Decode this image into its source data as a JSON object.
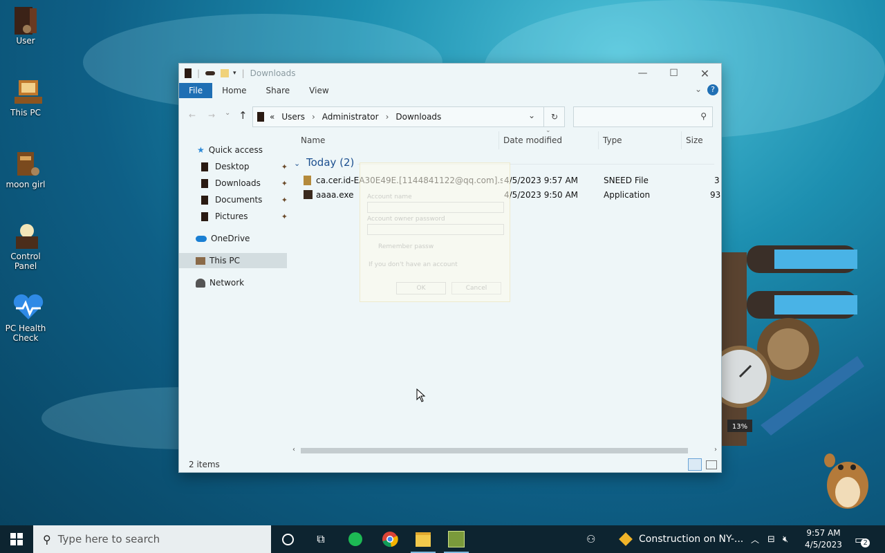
{
  "desktop": {
    "icons": [
      {
        "label": "User"
      },
      {
        "label": "This PC"
      },
      {
        "label": "moon girl"
      },
      {
        "label": "Control Panel"
      },
      {
        "label": "PC Health Check"
      }
    ],
    "gadget_percent": "13%"
  },
  "explorer": {
    "title": "Downloads",
    "ribbon_tabs": [
      "File",
      "Home",
      "Share",
      "View"
    ],
    "breadcrumb": [
      "Users",
      "Administrator",
      "Downloads"
    ],
    "breadcrumb_prefix": "«",
    "search_placeholder": "",
    "sidebar": {
      "quick_access": "Quick access",
      "pinned": [
        "Desktop",
        "Downloads",
        "Documents",
        "Pictures"
      ],
      "onedrive": "OneDrive",
      "this_pc": "This PC",
      "network": "Network"
    },
    "columns": [
      "Name",
      "Date modified",
      "Type",
      "Size"
    ],
    "group_header": "Today (2)",
    "files": [
      {
        "name": "ca.cer.id-EA30E49E.[1144841122@qq.com].sn...",
        "date": "4/5/2023 9:57 AM",
        "type": "SNEED File",
        "size": "3"
      },
      {
        "name": "aaaa.exe",
        "date": "4/5/2023 9:50 AM",
        "type": "Application",
        "size": "93"
      }
    ],
    "status": "2 items"
  },
  "ghost_dialog": {
    "account_name_label": "Account name",
    "password_label": "Account owner password",
    "remember": "Remember passw",
    "no_account": "If you don't have an account",
    "ok": "OK",
    "cancel": "Cancel"
  },
  "taskbar": {
    "search_placeholder": "Type here to search",
    "news": "Construction on NY-...",
    "time": "9:57 AM",
    "date": "4/5/2023",
    "notifications": "2"
  },
  "colors": {
    "accent": "#1f6fb4",
    "taskbar": "#0d2430"
  }
}
